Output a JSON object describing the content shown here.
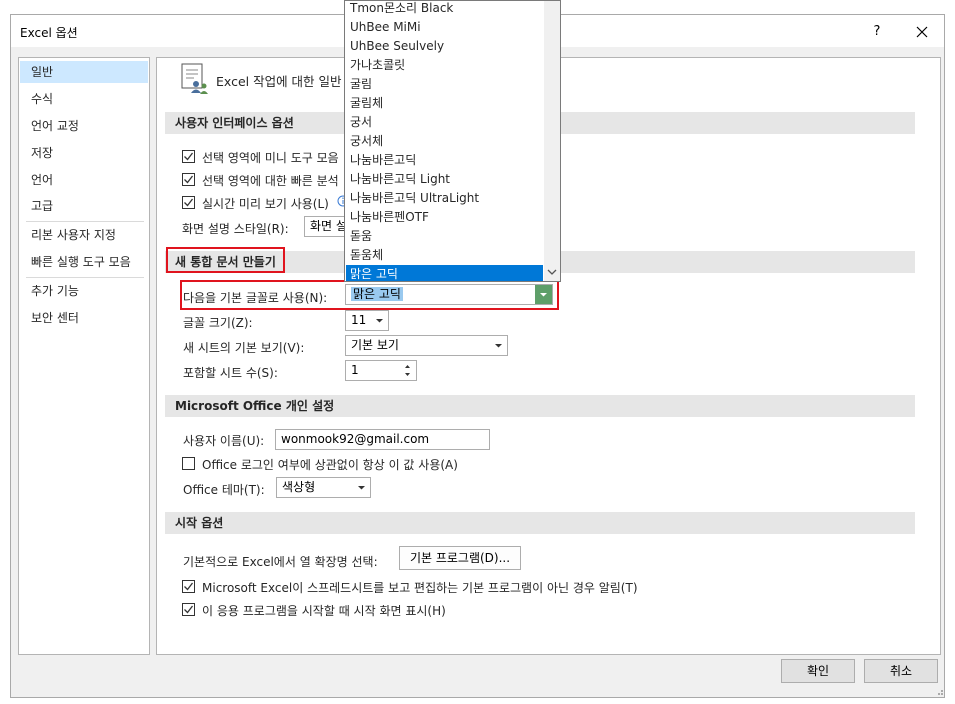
{
  "window": {
    "title": "Excel 옵션",
    "help_label": "?",
    "close_label": "✕"
  },
  "sidebar": {
    "items": [
      "일반",
      "수식",
      "언어 교정",
      "저장",
      "언어",
      "고급",
      "리본 사용자 지정",
      "빠른 실행 도구 모음",
      "추가 기능",
      "보안 센터"
    ]
  },
  "header": {
    "title": "Excel 작업에 대한 일반"
  },
  "sections": {
    "ui_options": {
      "title": "사용자 인터페이스 옵션",
      "mini_toolbar": "선택 영역에 미니 도구 모음",
      "quick_analysis": "선택 영역에 대한 빠른 분석",
      "live_preview": "실시간 미리 보기 사용(L)",
      "screentip_label": "화면 설명 스타일(R):",
      "screentip_value": "화면 설"
    },
    "new_workbook": {
      "title": "새 통합 문서 만들기",
      "font_label": "다음을 기본 글꼴로 사용(N):",
      "font_value": "맑은 고딕",
      "size_label": "글꼴 크기(Z):",
      "size_value": "11",
      "view_label": "새 시트의 기본 보기(V):",
      "view_value": "기본 보기",
      "sheets_label": "포함할 시트 수(S):",
      "sheets_value": "1"
    },
    "office": {
      "title": "Microsoft Office 개인 설정",
      "username_label": "사용자 이름(U):",
      "username_value": "wonmook92@gmail.com",
      "always_use": "Office 로그인 여부에 상관없이 항상 이 값 사용(A)",
      "theme_label": "Office 테마(T):",
      "theme_value": "색상형"
    },
    "startup": {
      "title": "시작 옵션",
      "ext_label": "기본적으로 Excel에서 열 확장명 선택:",
      "default_programs_btn": "기본 프로그램(D)...",
      "notify_default": "Microsoft Excel이 스프레드시트를 보고 편집하는 기본 프로그램이 아닌 경우 알림(T)",
      "show_start": "이 응용 프로그램을 시작할 때 시작 화면 표시(H)"
    }
  },
  "font_dropdown": {
    "items": [
      "Tmon몬소리 Black",
      "UhBee MiMi",
      "UhBee Seulvely",
      "가나초콜릿",
      "굴림",
      "굴림체",
      "궁서",
      "궁서체",
      "나눔바른고딕",
      "나눔바른고딕 Light",
      "나눔바른고딕 UltraLight",
      "나눔바른펜OTF",
      "돋움",
      "돋움체",
      "맑은 고딕"
    ],
    "selected": "맑은 고딕"
  },
  "footer": {
    "ok": "확인",
    "cancel": "취소"
  },
  "colors": {
    "highlight": "#e0141e",
    "selection": "#0078d7",
    "nav_active": "#cde8ff"
  }
}
